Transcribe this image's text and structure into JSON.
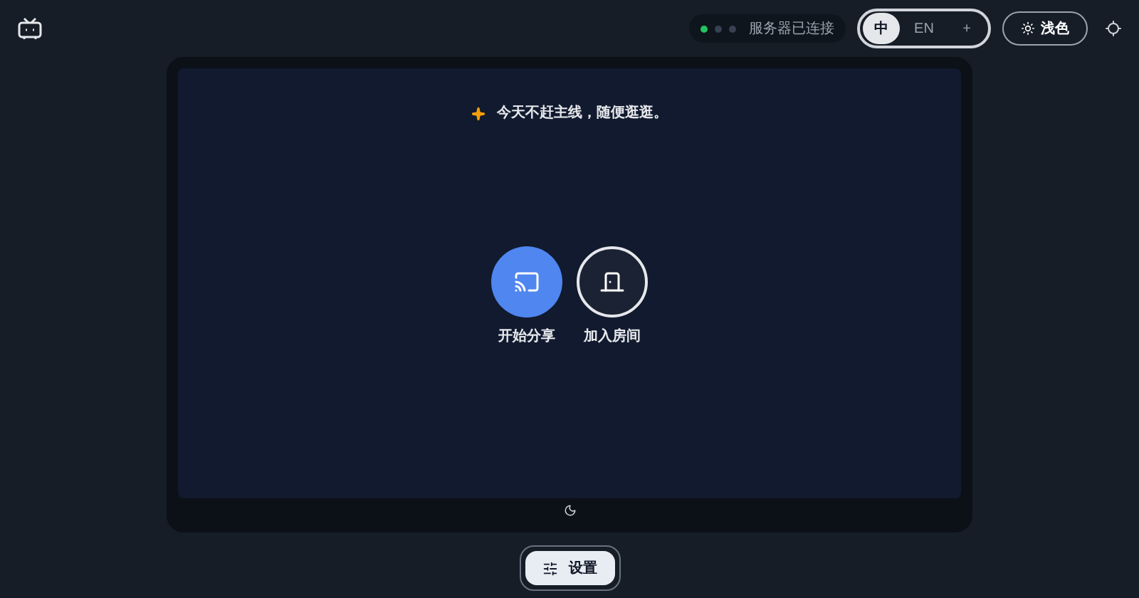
{
  "status": {
    "dots": [
      {
        "color": "#22c55e"
      },
      {
        "color": "#374151"
      },
      {
        "color": "#374151"
      }
    ],
    "label": "服务器已连接"
  },
  "languages": [
    {
      "label": "中",
      "selected": true
    },
    {
      "label": "EN",
      "selected": false
    },
    {
      "label": "+",
      "selected": false
    }
  ],
  "theme_button": "浅色",
  "tagline": "今天不赶主线，随便逛逛。",
  "actions": [
    {
      "kind": "share",
      "label": "开始分享"
    },
    {
      "kind": "join",
      "label": "加入房间"
    }
  ],
  "settings_button": "设置"
}
